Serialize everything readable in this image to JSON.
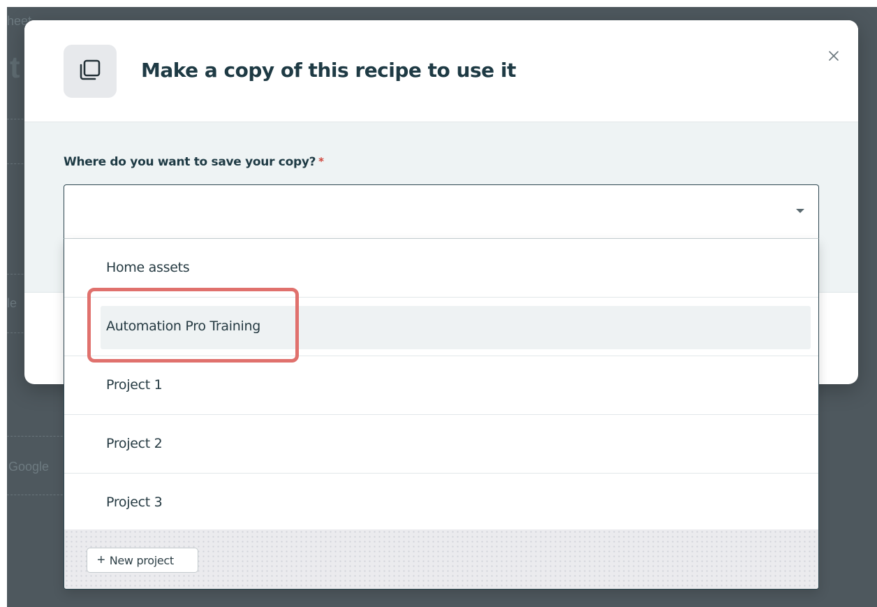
{
  "background": {
    "fragments": [
      "heet",
      "t",
      "le",
      "Google "
    ]
  },
  "modal": {
    "title": "Make a copy of this recipe to use it",
    "icon": "copy-icon",
    "close_icon": "close-icon",
    "field_label": "Where do you want to save your copy?",
    "required_marker": "*",
    "select_value": "",
    "options": [
      {
        "label": "Home assets",
        "highlighted": false
      },
      {
        "label": "Automation Pro Training",
        "highlighted": true
      },
      {
        "label": "Project 1",
        "highlighted": false
      },
      {
        "label": "Project 2",
        "highlighted": false
      },
      {
        "label": "Project 3",
        "highlighted": false
      }
    ],
    "new_project_label": "New project"
  },
  "colors": {
    "title": "#1e3a44",
    "required": "#d0443a",
    "highlight_outline": "#e0716d",
    "backdrop": "#4e585e"
  }
}
